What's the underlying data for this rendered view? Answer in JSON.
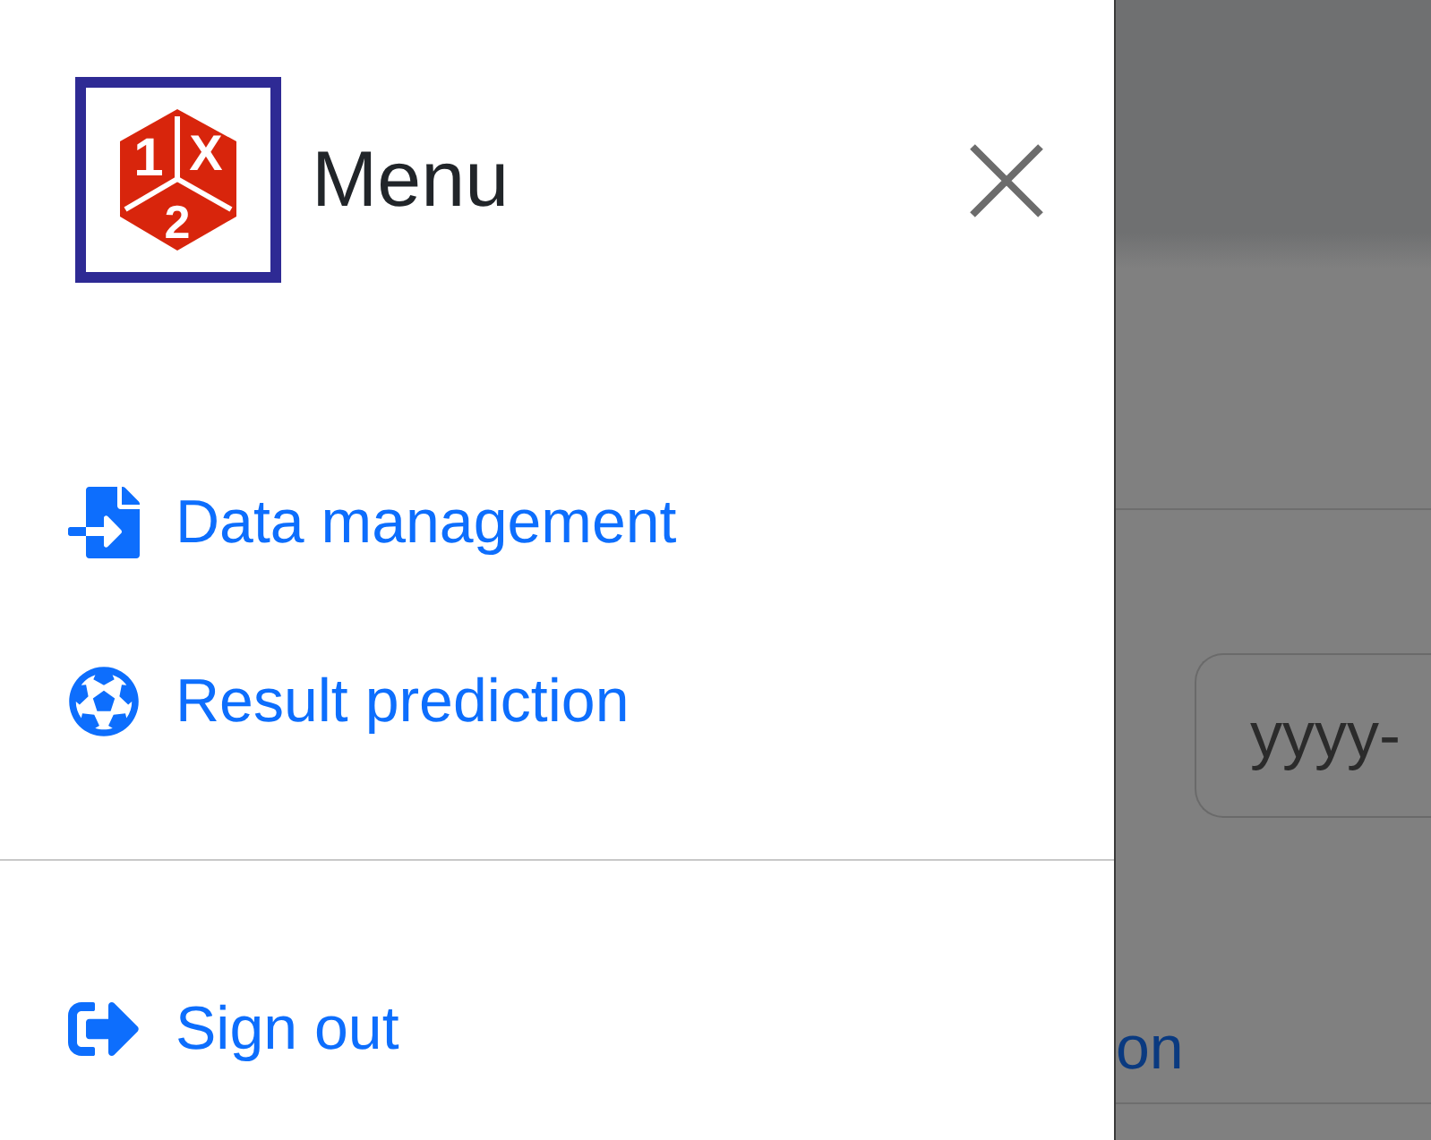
{
  "drawer": {
    "title": "Menu",
    "logo_glyphs": [
      "1",
      "X",
      "2"
    ],
    "items": [
      {
        "kind": "import",
        "label": "Data management"
      },
      {
        "kind": "ball",
        "label": "Result prediction"
      }
    ],
    "footer_items": [
      {
        "kind": "signout",
        "label": "Sign out"
      }
    ]
  },
  "background": {
    "date_placeholder": "yyyy-",
    "link_fragment": "on"
  }
}
